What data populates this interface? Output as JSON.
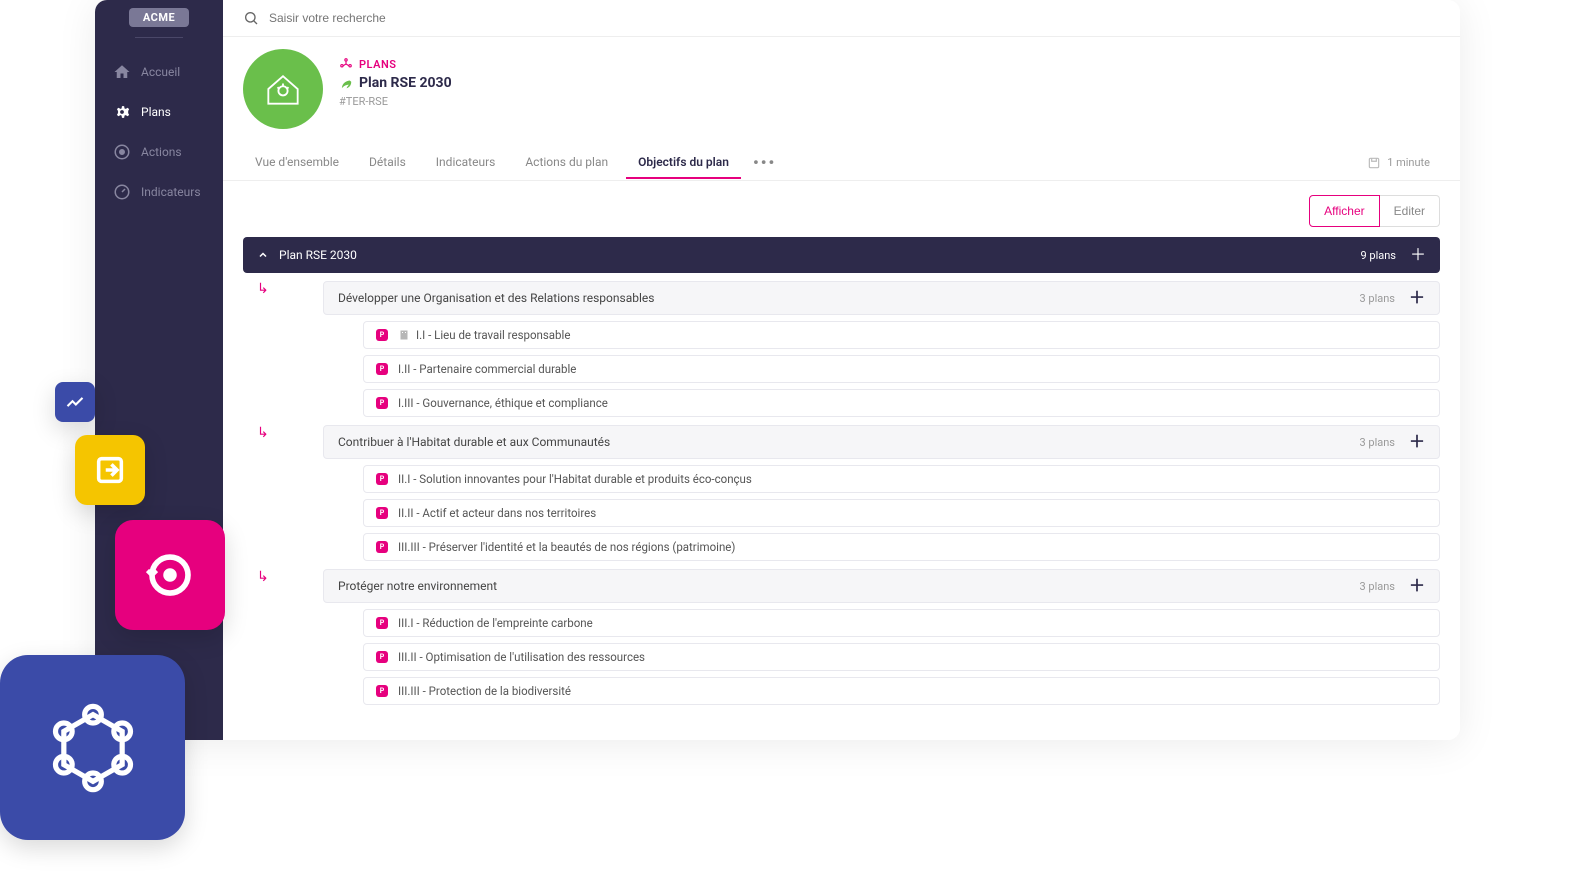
{
  "brand": "ACME",
  "search": {
    "placeholder": "Saisir votre recherche"
  },
  "sidebar": {
    "items": [
      {
        "label": "Accueil"
      },
      {
        "label": "Plans"
      },
      {
        "label": "Actions"
      },
      {
        "label": "Indicateurs"
      }
    ]
  },
  "breadcrumb": "PLANS",
  "plan": {
    "title": "Plan RSE 2030",
    "tag": "#TER-RSE"
  },
  "tabs": [
    {
      "label": "Vue d'ensemble"
    },
    {
      "label": "Détails"
    },
    {
      "label": "Indicateurs"
    },
    {
      "label": "Actions du plan"
    },
    {
      "label": "Objectifs du plan"
    }
  ],
  "time_since_save": "1 minute",
  "toolbar": {
    "display": "Afficher",
    "edit": "Editer"
  },
  "tree": {
    "root": {
      "title": "Plan RSE 2030",
      "count": "9 plans"
    },
    "groups": [
      {
        "title": "Développer une Organisation et des Relations responsables",
        "count": "3 plans",
        "items": [
          {
            "label": "I.I - Lieu de travail responsable",
            "has_building_icon": true
          },
          {
            "label": "I.II - Partenaire commercial durable"
          },
          {
            "label": "I.III - Gouvernance, éthique et compliance"
          }
        ]
      },
      {
        "title": "Contribuer à l'Habitat durable et aux Communautés",
        "count": "3 plans",
        "items": [
          {
            "label": "II.I - Solution innovantes pour l'Habitat durable et produits éco-conçus"
          },
          {
            "label": "II.II - Actif et acteur dans nos territoires"
          },
          {
            "label": "III.III - Préserver l'identité et la beautés de nos régions (patrimoine)"
          }
        ]
      },
      {
        "title": "Protéger notre environnement",
        "count": "3 plans",
        "items": [
          {
            "label": "III.I - Réduction de l'empreinte carbone"
          },
          {
            "label": "III.II - Optimisation de l'utilisation des ressources"
          },
          {
            "label": "III.III - Protection de la biodiversité"
          }
        ]
      }
    ]
  }
}
